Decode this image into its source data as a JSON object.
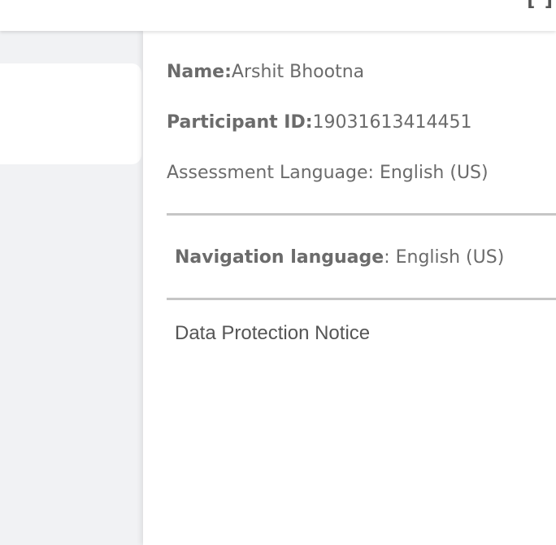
{
  "topbar": {
    "partial_glyph": "[ ]"
  },
  "profile_panel": {
    "name_label": "Name:",
    "name_value": "Arshit Bhootna",
    "participant_id_label": "Participant ID:",
    "participant_id_value": "19031613414451",
    "assessment_language_text": "Assessment Language: English (US)",
    "navigation_language_label": "Navigation language",
    "navigation_language_value": ": English (US)",
    "data_protection_link": "Data Protection Notice"
  }
}
